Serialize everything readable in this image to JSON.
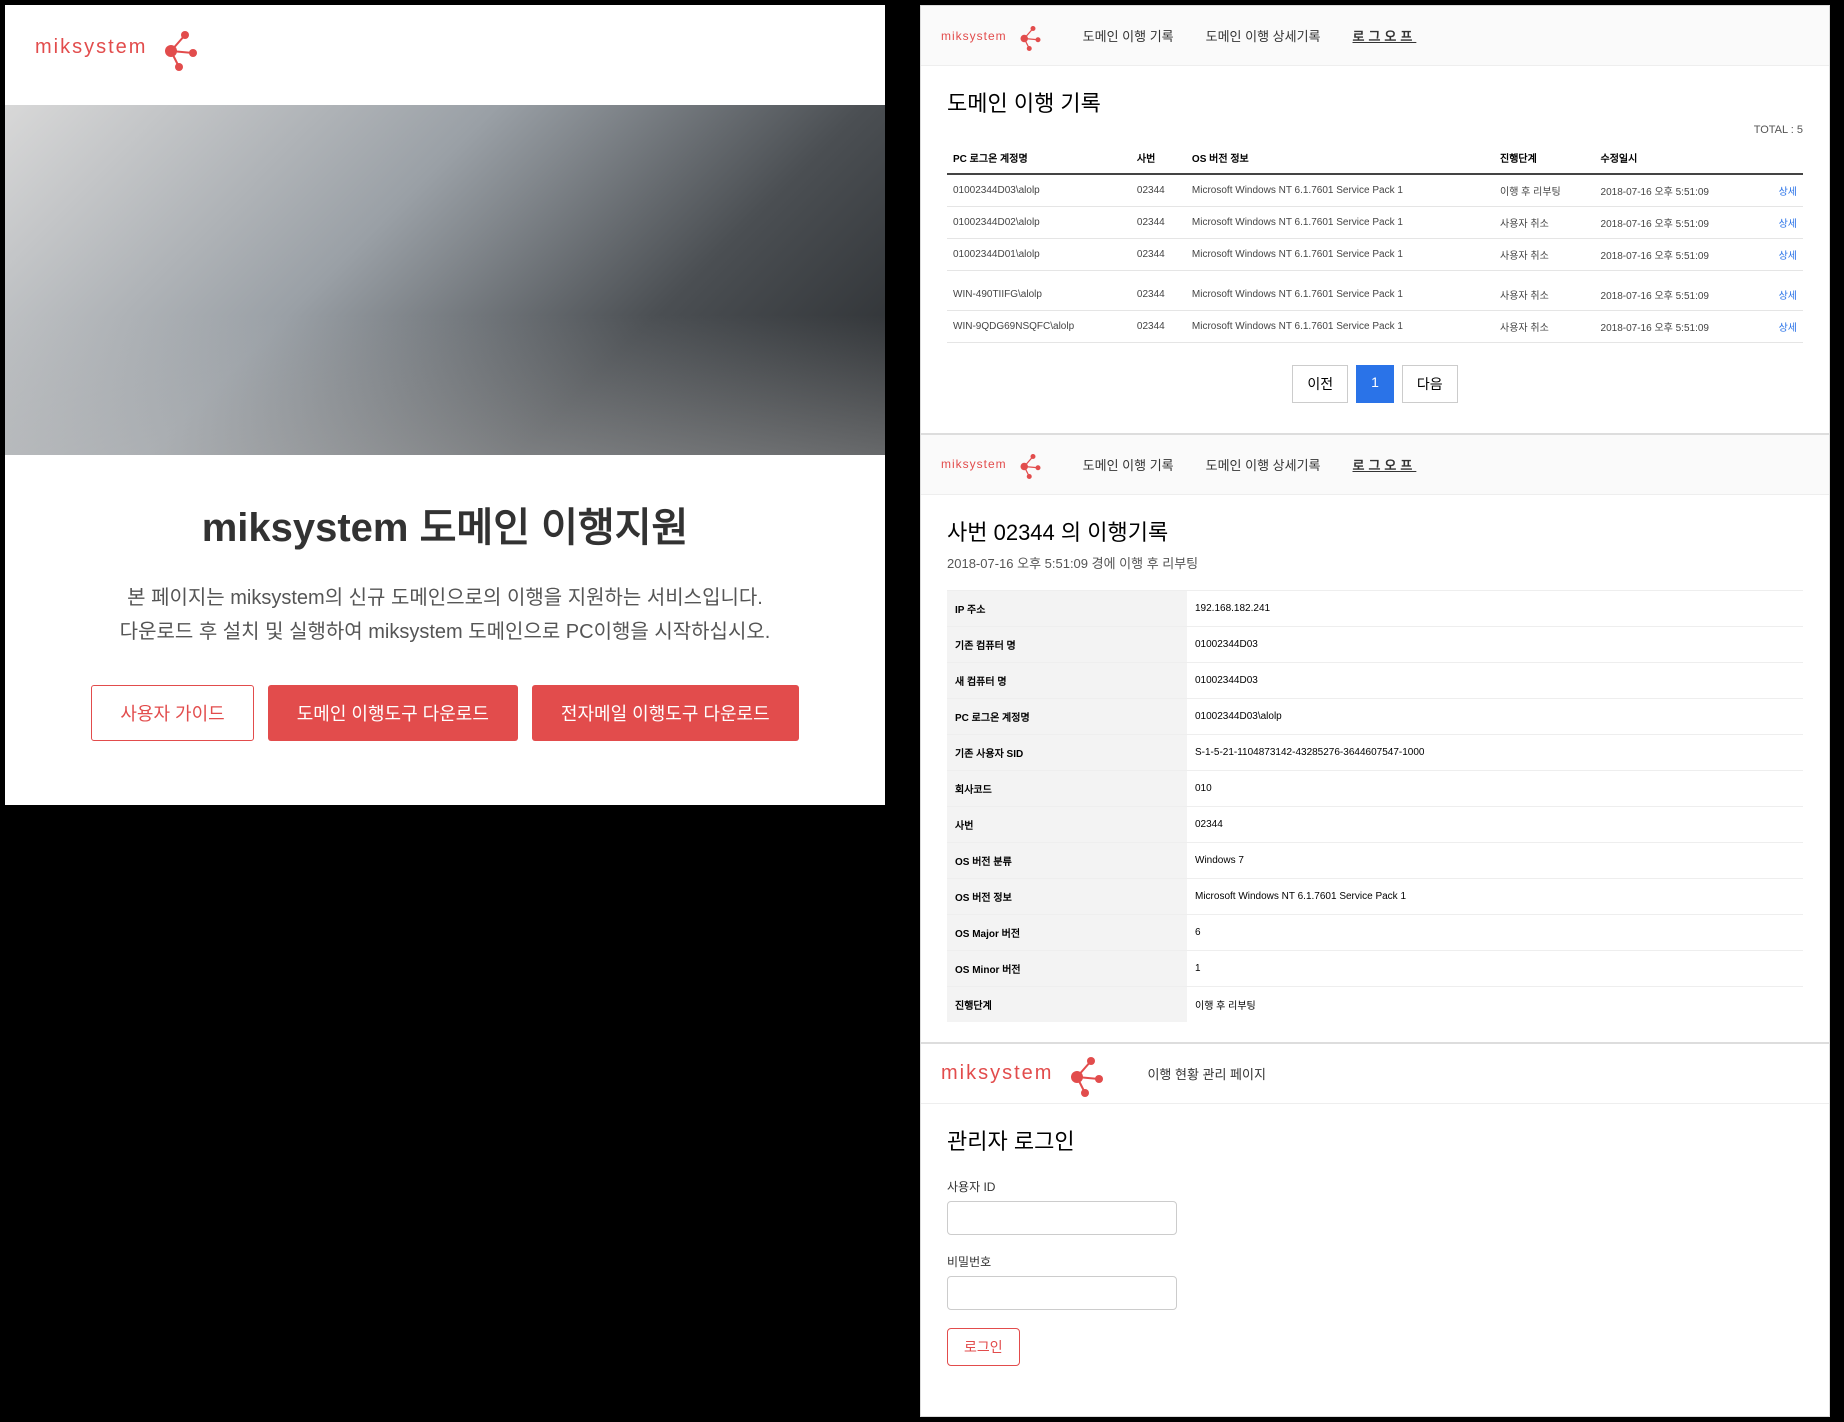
{
  "brand_text": "miksystem",
  "left": {
    "title": "miksystem 도메인 이행지원",
    "desc_line1": "본 페이지는 miksystem의 신규 도메인으로의 이행을 지원하는 서비스입니다.",
    "desc_line2": "다운로드 후 설치 및 실행하여 miksystem 도메인으로 PC이행을 시작하십시오.",
    "btn_guide": "사용자 가이드",
    "btn_domain": "도메인 이행도구 다운로드",
    "btn_email": "전자메일 이행도구 다운로드"
  },
  "nav": {
    "records": "도메인 이행 기록",
    "records_detail": "도메인 이행 상세기록",
    "logout": "로그오프"
  },
  "records": {
    "title": "도메인 이행 기록",
    "total_label": "TOTAL : 5",
    "cols": {
      "account": "PC 로그온 계정명",
      "empno": "사번",
      "os": "OS 버전 정보",
      "stage": "진행단계",
      "modified": "수정일시"
    },
    "rows": [
      {
        "account": "01002344D03\\alolp",
        "empno": "02344",
        "os": "Microsoft Windows NT 6.1.7601 Service Pack 1",
        "stage": "이행 후 리부팅",
        "modified": "2018-07-16 오후 5:51:09",
        "action": "상세"
      },
      {
        "account": "01002344D02\\alolp",
        "empno": "02344",
        "os": "Microsoft Windows NT 6.1.7601 Service Pack 1",
        "stage": "사용자 취소",
        "modified": "2018-07-16 오후 5:51:09",
        "action": "상세"
      },
      {
        "account": "01002344D01\\alolp",
        "empno": "02344",
        "os": "Microsoft Windows NT 6.1.7601 Service Pack 1",
        "stage": "사용자 취소",
        "modified": "2018-07-16 오후 5:51:09",
        "action": "상세"
      },
      {
        "account": "WIN-490TIIFG\\alolp",
        "empno": "02344",
        "os": "Microsoft Windows NT 6.1.7601 Service Pack 1",
        "stage": "사용자 취소",
        "modified": "2018-07-16 오후 5:51:09",
        "action": "상세"
      },
      {
        "account": "WIN-9QDG69NSQFC\\alolp",
        "empno": "02344",
        "os": "Microsoft Windows NT 6.1.7601 Service Pack 1",
        "stage": "사용자 취소",
        "modified": "2018-07-16 오후 5:51:09",
        "action": "상세"
      }
    ],
    "pager": {
      "prev": "이전",
      "page": "1",
      "next": "다음"
    }
  },
  "detail": {
    "title": "사번 02344 의 이행기록",
    "subtitle": "2018-07-16 오후 5:51:09 경에 이행 후 리부팅",
    "rows": [
      {
        "k": "IP 주소",
        "v": "192.168.182.241"
      },
      {
        "k": "기존 컴퓨터 명",
        "v": "01002344D03"
      },
      {
        "k": "새 컴퓨터 명",
        "v": "01002344D03"
      },
      {
        "k": "PC 로그온 계정명",
        "v": "01002344D03\\alolp"
      },
      {
        "k": "기존 사용자 SID",
        "v": "S-1-5-21-1104873142-43285276-3644607547-1000"
      },
      {
        "k": "회사코드",
        "v": "010"
      },
      {
        "k": "사번",
        "v": "02344"
      },
      {
        "k": "OS 버전 분류",
        "v": "Windows 7"
      },
      {
        "k": "OS 버전 정보",
        "v": "Microsoft Windows NT 6.1.7601 Service Pack 1"
      },
      {
        "k": "OS Major 버전",
        "v": "6"
      },
      {
        "k": "OS Minor 버전",
        "v": "1"
      },
      {
        "k": "진행단계",
        "v": "이행 후 리부팅"
      }
    ]
  },
  "login": {
    "header_desc": "이행 현황 관리 페이지",
    "title": "관리자 로그인",
    "user_label": "사용자 ID",
    "pass_label": "비밀번호",
    "submit": "로그인"
  }
}
